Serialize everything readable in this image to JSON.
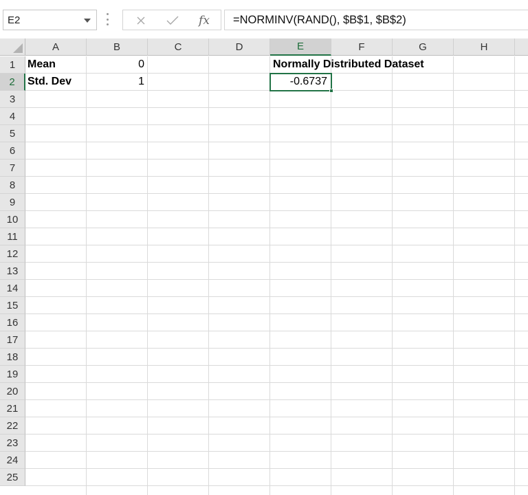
{
  "formula_bar": {
    "name_box": "E2",
    "cancel_icon": "close-icon",
    "enter_icon": "check-icon",
    "fx_label": "fx",
    "formula": "=NORMINV(RAND(), $B$1, $B$2)"
  },
  "columns": [
    "A",
    "B",
    "C",
    "D",
    "E",
    "F",
    "G",
    "H"
  ],
  "rows": [
    "1",
    "2",
    "3",
    "4",
    "5",
    "6",
    "7",
    "8",
    "9",
    "10",
    "11",
    "12",
    "13",
    "14",
    "15",
    "16",
    "17",
    "18",
    "19",
    "20",
    "21",
    "22",
    "23",
    "24",
    "25"
  ],
  "cells": {
    "A1": "Mean",
    "B1": "0",
    "A2": "Std. Dev",
    "B2": "1",
    "E1": "Normally Distributed Dataset",
    "E2": "-0.6737"
  },
  "selection": {
    "cell": "E2",
    "column": "E",
    "row": "2"
  },
  "colors": {
    "accent": "#217346",
    "header_bg": "#e6e6e6",
    "gridline": "#dadada"
  }
}
